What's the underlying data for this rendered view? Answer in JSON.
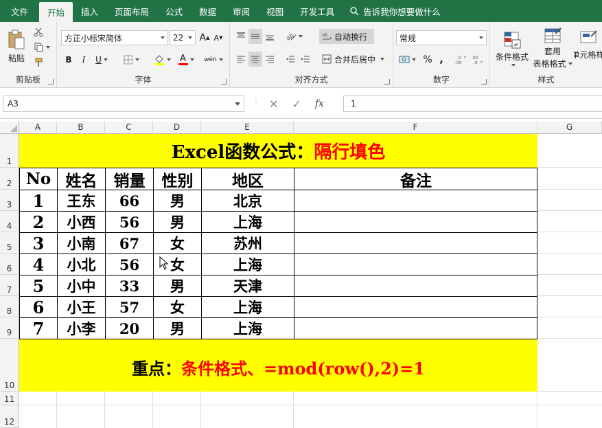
{
  "tabs": [
    "文件",
    "开始",
    "插入",
    "页面布局",
    "公式",
    "数据",
    "审阅",
    "视图",
    "开发工具"
  ],
  "active_tab": "开始",
  "tell_me": "告诉我你想要做什么",
  "ribbon": {
    "clipboard": {
      "paste_label": "粘贴",
      "group_label": "剪贴板"
    },
    "font": {
      "font_name": "方正小标宋简体",
      "font_size": "22",
      "grow_label": "A",
      "shrink_label": "A",
      "bold": "B",
      "italic": "I",
      "underline": "U",
      "font_color_label": "A",
      "phonetic_label": "wén",
      "group_label": "字体"
    },
    "alignment": {
      "wrap_text": "自动换行",
      "merge_center": "合并后居中",
      "group_label": "对齐方式"
    },
    "number": {
      "format": "常规",
      "percent": "%",
      "comma": ",",
      "group_label": "数字"
    },
    "styles": {
      "conditional": "条件格式",
      "table_format_1": "套用",
      "table_format_2": "表格格式",
      "cell_styles": "单元格样",
      "group_label": "样式"
    }
  },
  "formula_bar": {
    "name_box": "A3",
    "fx": "fx",
    "value": "1"
  },
  "columns": [
    "A",
    "B",
    "C",
    "D",
    "E",
    "F",
    "G"
  ],
  "rows": [
    "1",
    "2",
    "3",
    "4",
    "5",
    "6",
    "7",
    "8",
    "9",
    "10",
    "11",
    "12"
  ],
  "sheet": {
    "title_black": "Excel函数公式：",
    "title_red": "隔行填色",
    "headers": [
      "No",
      "姓名",
      "销量",
      "性别",
      "地区",
      "备注"
    ],
    "data": [
      [
        "1",
        "王东",
        "66",
        "男",
        "北京"
      ],
      [
        "2",
        "小西",
        "56",
        "男",
        "上海"
      ],
      [
        "3",
        "小南",
        "67",
        "女",
        "苏州"
      ],
      [
        "4",
        "小北",
        "56",
        "女",
        "上海"
      ],
      [
        "5",
        "小中",
        "33",
        "男",
        "天津"
      ],
      [
        "6",
        "小王",
        "57",
        "女",
        "上海"
      ],
      [
        "7",
        "小李",
        "20",
        "男",
        "上海"
      ]
    ],
    "note_black": "重点：",
    "note_red": "条件格式、=mod(row(),2)=1"
  },
  "colors": {
    "excel_green": "#217346",
    "highlight": "#ffff00",
    "accent_red": "#ff0000"
  }
}
